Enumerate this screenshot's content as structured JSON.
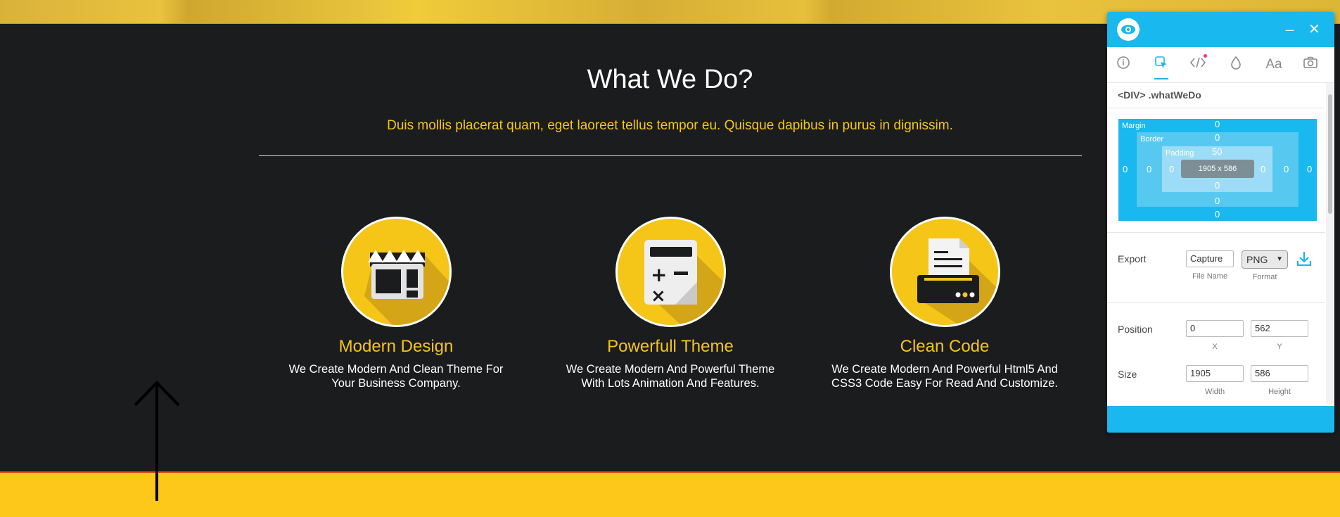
{
  "page": {
    "title": "What We Do?",
    "subtitle": "Duis mollis placerat quam, eget laoreet tellus tempor eu. Quisque dapibus in purus in dignissim.",
    "features": [
      {
        "title": "Modern Design",
        "desc": "We Create Modern And Clean Theme For Your Business Company.",
        "icon": "shop-icon"
      },
      {
        "title": "Powerfull Theme",
        "desc": "We Create Modern And Powerful Theme With Lots Animation And Features.",
        "icon": "calculator-icon"
      },
      {
        "title": "Clean Code",
        "desc": "We Create Modern And Powerful Html5 And CSS3 Code Easy For Read And Customize.",
        "icon": "printer-icon"
      }
    ]
  },
  "colors": {
    "accent": "#f5c518",
    "background": "#1b1c1e",
    "panel_accent": "#19b8ee"
  },
  "panel": {
    "minimize": "_",
    "close": "✕",
    "tabs": [
      "info-icon",
      "select-icon",
      "code-icon",
      "color-drop-icon",
      "font-icon",
      "camera-icon"
    ],
    "font_tab_label": "Aa",
    "element_label": "<DIV> .whatWeDo",
    "box_model": {
      "margin_label": "Margin",
      "border_label": "Border",
      "padding_label": "Padding",
      "margin": {
        "top": "0",
        "right": "0",
        "bottom": "0",
        "left": "0"
      },
      "border": {
        "top": "0",
        "right": "0",
        "bottom": "0",
        "left": "0"
      },
      "padding": {
        "top": "50",
        "right": "0",
        "bottom": "0",
        "left": "0"
      },
      "content": "1905 x 586"
    },
    "export": {
      "label": "Export",
      "file_name": "Capture",
      "file_name_caption": "File Name",
      "format": "PNG",
      "format_caption": "Format"
    },
    "position": {
      "label": "Position",
      "x": "0",
      "y": "562",
      "x_caption": "X",
      "y_caption": "Y"
    },
    "size": {
      "label": "Size",
      "width": "1905",
      "height": "586",
      "width_caption": "Width",
      "height_caption": "Height"
    }
  }
}
